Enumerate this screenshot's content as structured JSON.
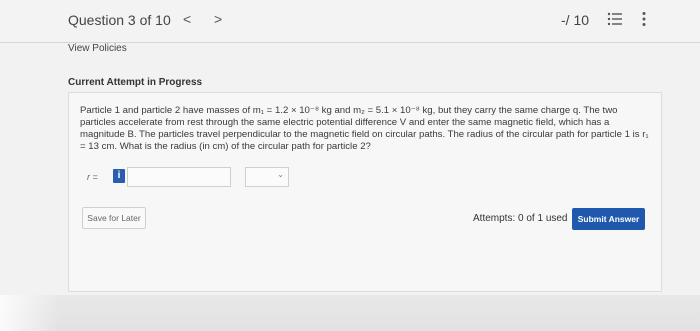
{
  "header": {
    "question_title": "Question 3 of 10",
    "prev_icon": "chevron-left-icon",
    "next_icon": "chevron-right-icon",
    "prev_glyph": "<",
    "next_glyph": ">",
    "score": "-/ 10",
    "list_icon": "list-icon",
    "more_icon": "more-vertical-icon"
  },
  "links": {
    "view_policies": "View Policies"
  },
  "attempt": {
    "heading": "Current Attempt in Progress",
    "problem_text": "Particle 1 and particle 2 have masses of m₁ = 1.2 × 10⁻⁸ kg and m₂ = 5.1 × 10⁻⁸ kg, but they carry the same charge q. The two particles accelerate from rest through the same electric potential difference V and enter the same magnetic field, which has a magnitude B. The particles travel perpendicular to the magnetic field on circular paths. The radius of the circular path for particle 1 is r₁ = 13 cm. What is the radius (in cm) of the circular path for particle 2?",
    "answer_label": "r =",
    "info_glyph": "i",
    "answer_value": "",
    "unit_selected": "",
    "save_label": "Save for Later",
    "attempts_text": "Attempts: 0 of 1 used",
    "submit_label": "Submit Answer"
  },
  "colors": {
    "accent": "#1f58ad",
    "info": "#2a5db0",
    "background": "#f2f2f2"
  }
}
